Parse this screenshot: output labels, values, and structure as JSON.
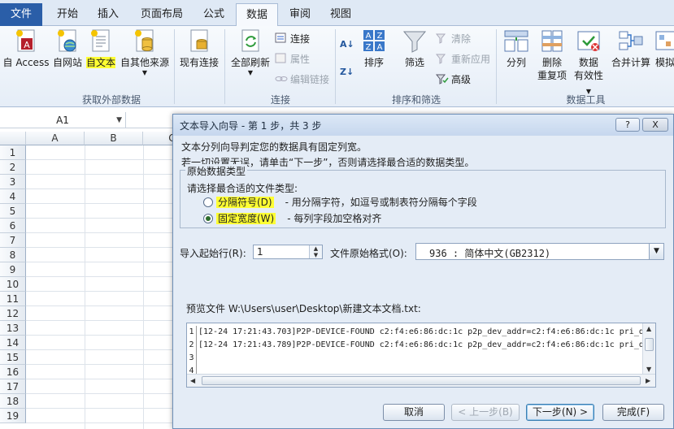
{
  "tabs": {
    "file": "文件",
    "home": "开始",
    "insert": "插入",
    "page_layout": "页面布局",
    "formulas": "公式",
    "data": "数据",
    "review": "审阅",
    "view": "视图"
  },
  "ribbon": {
    "from_access": "自 Access",
    "from_web": "自网站",
    "from_text": "自文本",
    "from_other": "自其他来源",
    "existing_conn": "现有连接",
    "refresh_all": "全部刷新",
    "connections": "连接",
    "properties": "属性",
    "edit_links": "编辑链接",
    "sort": "排序",
    "filter": "筛选",
    "clear": "清除",
    "reapply": "重新应用",
    "advanced": "高级",
    "text_to_columns": "分列",
    "remove_dup_1": "删除",
    "remove_dup_2": "重复项",
    "validation_1": "数据",
    "validation_2": "有效性",
    "consolidate": "合并计算",
    "whatif": "模拟",
    "group_external": "获取外部数据",
    "group_connections": "连接",
    "group_sort_filter": "排序和筛选",
    "group_data_tools": "数据工具"
  },
  "formula_bar": {
    "name_box": "A1"
  },
  "grid": {
    "columns": [
      "A",
      "B",
      "C"
    ],
    "rows": [
      "1",
      "2",
      "3",
      "4",
      "5",
      "6",
      "7",
      "8",
      "9",
      "10",
      "11",
      "12",
      "13",
      "14",
      "15",
      "16",
      "17",
      "18",
      "19"
    ]
  },
  "dialog": {
    "title": "文本导入向导 - 第 1 步，共 3 步",
    "help_btn": "?",
    "close_btn": "X",
    "intro_1": "文本分列向导判定您的数据具有固定列宽。",
    "intro_2": "若一切设置无误，请单击“下一步”，否则请选择最合适的数据类型。",
    "group_title": "原始数据类型",
    "choose_type": "请选择最合适的文件类型:",
    "opt_delimited": "分隔符号(D)",
    "opt_delimited_desc": "- 用分隔字符，如逗号或制表符分隔每个字段",
    "opt_fixed": "固定宽度(W)",
    "opt_fixed_desc": "- 每列字段加空格对齐",
    "start_row_label": "导入起始行(R):",
    "start_row_value": "1",
    "origin_label": "文件原始格式(O):",
    "origin_value": "936 : 简体中文(GB2312)",
    "preview_label": "预览文件 W:\\Users\\user\\Desktop\\新建文本文档.txt:",
    "preview_lines": [
      {
        "n": "1",
        "text": "[12-24 17:21:43.703]P2P-DEVICE-FOUND c2:f4:e6:86:dc:1c p2p_dev_addr=c2:f4:e6:86:dc:1c pri_d"
      },
      {
        "n": "2",
        "text": "[12-24 17:21:43.789]P2P-DEVICE-FOUND c2:f4:e6:86:dc:1c p2p_dev_addr=c2:f4:e6:86:dc:1c pri_d"
      },
      {
        "n": "3",
        "text": ""
      },
      {
        "n": "4",
        "text": ""
      }
    ],
    "btn_cancel": "取消",
    "btn_back": "< 上一步(B)",
    "btn_next": "下一步(N) >",
    "btn_finish": "完成(F)"
  }
}
